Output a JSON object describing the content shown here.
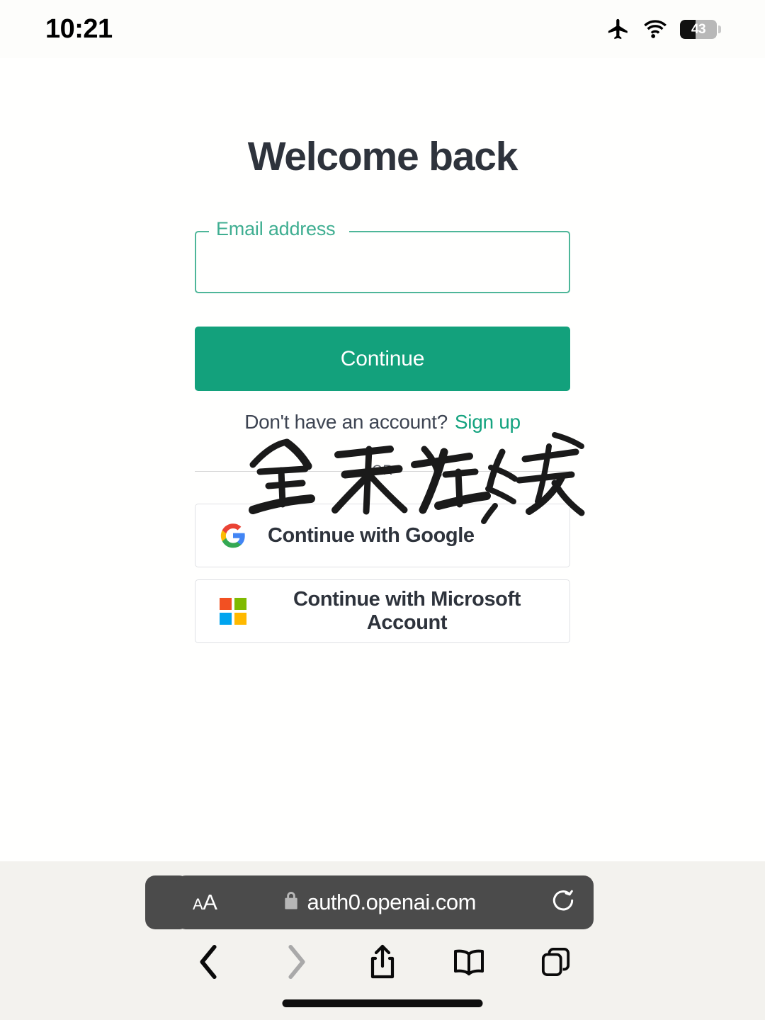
{
  "status_bar": {
    "time": "10:21",
    "airplane_icon": "airplane-mode-icon",
    "wifi_icon": "wifi-icon",
    "battery_percent": "43",
    "battery_level": 43
  },
  "page": {
    "title": "Welcome back",
    "email_field": {
      "label": "Email address",
      "value": "",
      "placeholder": ""
    },
    "continue_button": "Continue",
    "signup_prompt": "Don't have an account?",
    "signup_link": "Sign up",
    "divider_text": "OR",
    "social_buttons": [
      {
        "label": "Continue with Google",
        "logo": "google-logo"
      },
      {
        "label": "Continue with Microsoft Account",
        "logo": "microsoft-logo"
      }
    ],
    "watermark_text": "全天在线"
  },
  "browser": {
    "text_size_small": "A",
    "text_size_big": "A",
    "lock_icon": "lock-icon",
    "url": "auth0.openai.com",
    "reload_icon": "reload-icon",
    "toolbar": [
      {
        "name": "back",
        "icon": "chevron-left-icon"
      },
      {
        "name": "forward",
        "icon": "chevron-right-icon"
      },
      {
        "name": "share",
        "icon": "share-icon"
      },
      {
        "name": "bookmarks",
        "icon": "book-icon"
      },
      {
        "name": "tabs",
        "icon": "tabs-icon"
      }
    ]
  },
  "colors": {
    "accent_green": "#13a17c",
    "link_green": "#14a37f",
    "label_green": "#3fae91",
    "heading": "#2e333c",
    "chrome_gray": "#4b4b4b",
    "google_red": "#ea4335",
    "google_yellow": "#fbbc05",
    "google_green": "#34a853",
    "google_blue": "#4285f4",
    "ms_red": "#f25022",
    "ms_green": "#7fba00",
    "ms_blue": "#00a4ef",
    "ms_yellow": "#ffb900"
  }
}
